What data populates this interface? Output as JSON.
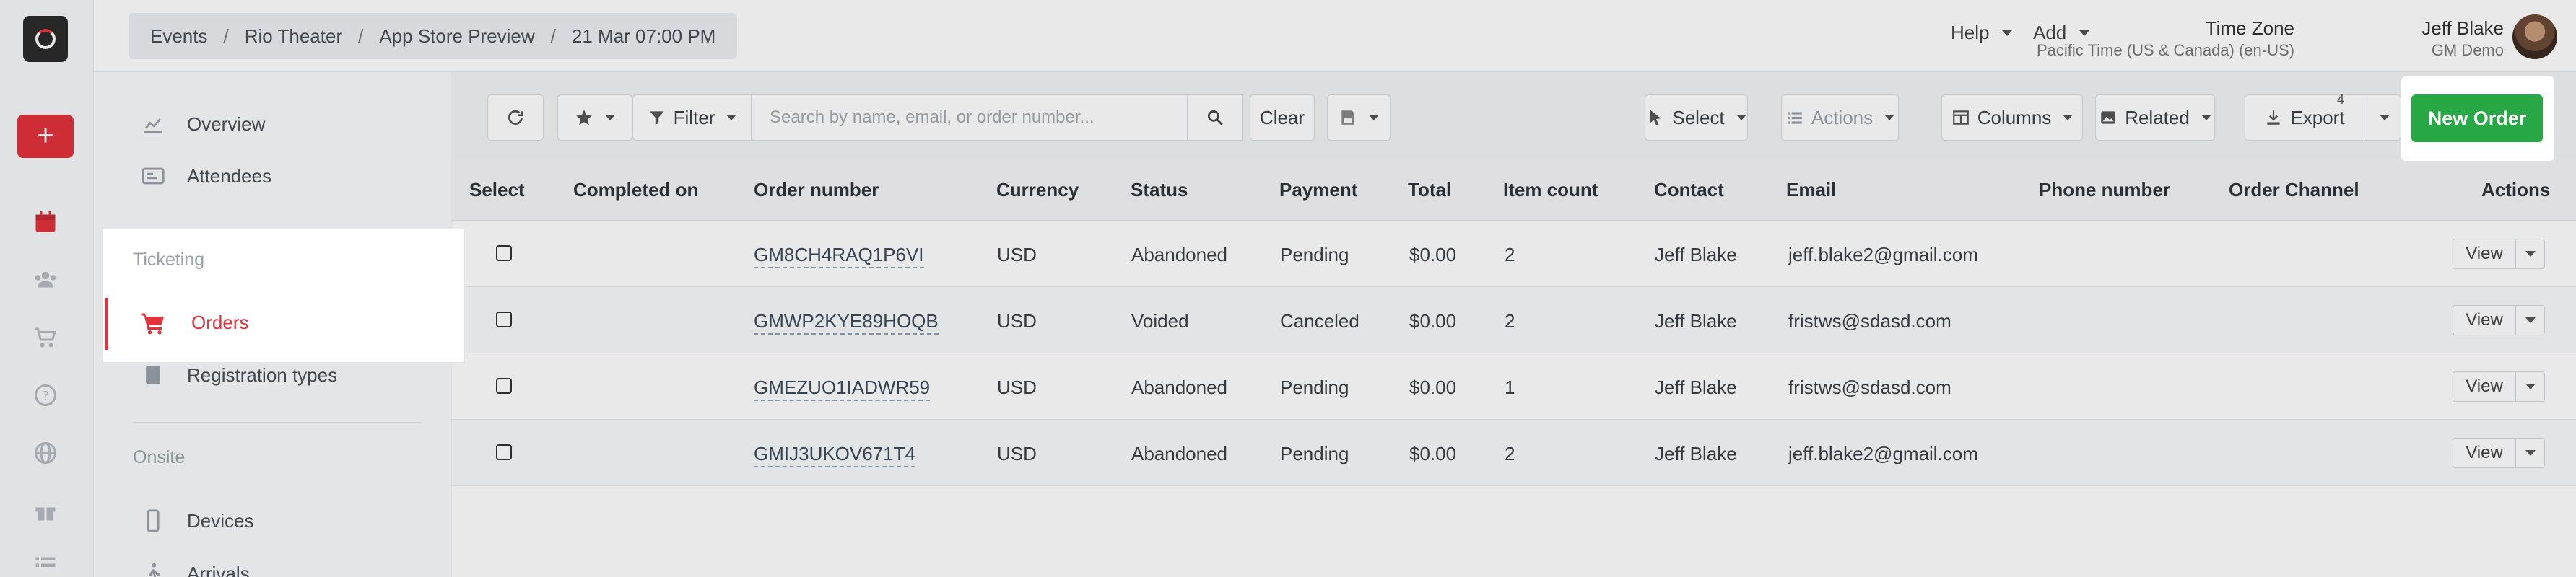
{
  "topbar": {
    "breadcrumb": [
      "Events",
      "Rio Theater",
      "App Store Preview",
      "21 Mar 07:00 PM"
    ],
    "help_label": "Help",
    "add_label": "Add",
    "timezone_title": "Time Zone",
    "timezone_value": "Pacific Time (US & Canada) (en-US)",
    "user_name": "Jeff Blake",
    "user_org": "GM Demo"
  },
  "rail": {
    "add_symbol": "+",
    "icons": [
      "calendar-icon",
      "users-icon",
      "cart-icon",
      "help-circle-icon",
      "globe-icon",
      "gift-icon",
      "list-icon"
    ]
  },
  "subnav": {
    "overview": "Overview",
    "attendees": "Attendees",
    "ticketing_header": "Ticketing",
    "orders": "Orders",
    "registration_types": "Registration types",
    "onsite_header": "Onsite",
    "devices": "Devices",
    "arrivals": "Arrivals"
  },
  "toolbar": {
    "filter_label": "Filter",
    "search_placeholder": "Search by name, email, or order number...",
    "clear_label": "Clear",
    "select_label": "Select",
    "actions_label": "Actions",
    "columns_label": "Columns",
    "related_label": "Related",
    "export_label": "Export",
    "export_badge": "4",
    "new_order_label": "New Order"
  },
  "table": {
    "headers": {
      "select": "Select",
      "completed_on": "Completed on",
      "order_number": "Order number",
      "currency": "Currency",
      "status": "Status",
      "payment": "Payment",
      "total": "Total",
      "item_count": "Item count",
      "contact": "Contact",
      "email": "Email",
      "phone": "Phone number",
      "channel": "Order Channel",
      "actions": "Actions"
    },
    "view_label": "View",
    "rows": [
      {
        "order_number": "GM8CH4RAQ1P6VI",
        "currency": "USD",
        "status": "Abandoned",
        "payment": "Pending",
        "total": "$0.00",
        "item_count": "2",
        "contact": "Jeff Blake",
        "email": "jeff.blake2@gmail.com"
      },
      {
        "order_number": "GMWP2KYE89HOQB",
        "currency": "USD",
        "status": "Voided",
        "payment": "Canceled",
        "total": "$0.00",
        "item_count": "2",
        "contact": "Jeff Blake",
        "email": "fristws@sdasd.com"
      },
      {
        "order_number": "GMEZUO1IADWR59",
        "currency": "USD",
        "status": "Abandoned",
        "payment": "Pending",
        "total": "$0.00",
        "item_count": "1",
        "contact": "Jeff Blake",
        "email": "fristws@sdasd.com"
      },
      {
        "order_number": "GMIJ3UKOV671T4",
        "currency": "USD",
        "status": "Abandoned",
        "payment": "Pending",
        "total": "$0.00",
        "item_count": "2",
        "contact": "Jeff Blake",
        "email": "jeff.blake2@gmail.com"
      }
    ]
  },
  "colors": {
    "brand_red": "#e3323c",
    "new_order_green": "#28a745"
  }
}
